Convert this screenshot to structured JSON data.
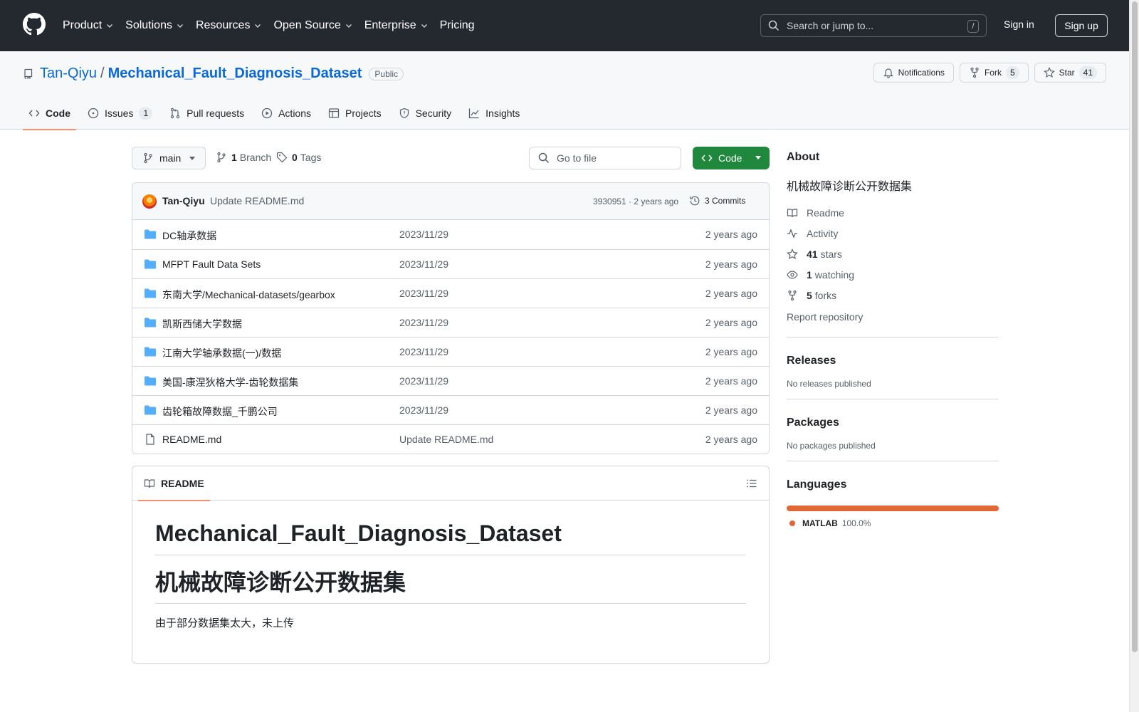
{
  "header": {
    "nav": [
      {
        "label": "Product",
        "dropdown": true
      },
      {
        "label": "Solutions",
        "dropdown": true
      },
      {
        "label": "Resources",
        "dropdown": true
      },
      {
        "label": "Open Source",
        "dropdown": true
      },
      {
        "label": "Enterprise",
        "dropdown": true
      },
      {
        "label": "Pricing",
        "dropdown": false
      }
    ],
    "search_placeholder": "Search or jump to...",
    "search_shortcut": "/",
    "sign_in": "Sign in",
    "sign_up": "Sign up"
  },
  "repo": {
    "owner": "Tan-Qiyu",
    "separator": "/",
    "name": "Mechanical_Fault_Diagnosis_Dataset",
    "visibility": "Public",
    "notifications_label": "Notifications",
    "fork_label": "Fork",
    "fork_count": "5",
    "star_label": "Star",
    "star_count": "41"
  },
  "tabs": [
    {
      "label": "Code",
      "icon": "code-icon",
      "active": true,
      "count": ""
    },
    {
      "label": "Issues",
      "icon": "issue-icon",
      "active": false,
      "count": "1"
    },
    {
      "label": "Pull requests",
      "icon": "pull-request-icon",
      "active": false,
      "count": ""
    },
    {
      "label": "Actions",
      "icon": "play-icon",
      "active": false,
      "count": ""
    },
    {
      "label": "Projects",
      "icon": "table-icon",
      "active": false,
      "count": ""
    },
    {
      "label": "Security",
      "icon": "shield-icon",
      "active": false,
      "count": ""
    },
    {
      "label": "Insights",
      "icon": "graph-icon",
      "active": false,
      "count": ""
    }
  ],
  "controls": {
    "branch": "main",
    "branch_count": "1",
    "branch_label": "Branch",
    "tag_count": "0",
    "tag_label": "Tags",
    "go_to_file": "Go to file",
    "code_button": "Code"
  },
  "commit": {
    "author": "Tan-Qiyu",
    "message": "Update README.md",
    "hash_time": "3930951 · 2 years ago",
    "commits": "3 Commits"
  },
  "files": [
    {
      "name": "DC轴承数据",
      "type": "folder",
      "message": "2023/11/29",
      "age": "2 years ago"
    },
    {
      "name": "MFPT Fault Data Sets",
      "type": "folder",
      "message": "2023/11/29",
      "age": "2 years ago"
    },
    {
      "name": "东南大学/Mechanical-datasets/gearbox",
      "type": "folder",
      "message": "2023/11/29",
      "age": "2 years ago"
    },
    {
      "name": "凯斯西储大学数据",
      "type": "folder",
      "message": "2023/11/29",
      "age": "2 years ago"
    },
    {
      "name": "江南大学轴承数据(一)/数据",
      "type": "folder",
      "message": "2023/11/29",
      "age": "2 years ago"
    },
    {
      "name": "美国-康涅狄格大学-齿轮数据集",
      "type": "folder",
      "message": "2023/11/29",
      "age": "2 years ago"
    },
    {
      "name": "齿轮箱故障数据_千鹏公司",
      "type": "folder",
      "message": "2023/11/29",
      "age": "2 years ago"
    },
    {
      "name": "README.md",
      "type": "file",
      "message": "Update README.md",
      "age": "2 years ago"
    }
  ],
  "readme": {
    "tab": "README",
    "h1": "Mechanical_Fault_Diagnosis_Dataset",
    "h2": "机械故障诊断公开数据集",
    "p": "由于部分数据集太大，未上传"
  },
  "about": {
    "title": "About",
    "description": "机械故障诊断公开数据集",
    "readme": "Readme",
    "activity": "Activity",
    "stars_count": "41",
    "stars_label": "stars",
    "watching_count": "1",
    "watching_label": "watching",
    "forks_count": "5",
    "forks_label": "forks",
    "report": "Report repository"
  },
  "releases": {
    "title": "Releases",
    "text": "No releases published"
  },
  "packages": {
    "title": "Packages",
    "text": "No packages published"
  },
  "languages": {
    "title": "Languages",
    "items": [
      {
        "name": "MATLAB",
        "percent": "100.0%",
        "color": "#e16737"
      }
    ]
  }
}
